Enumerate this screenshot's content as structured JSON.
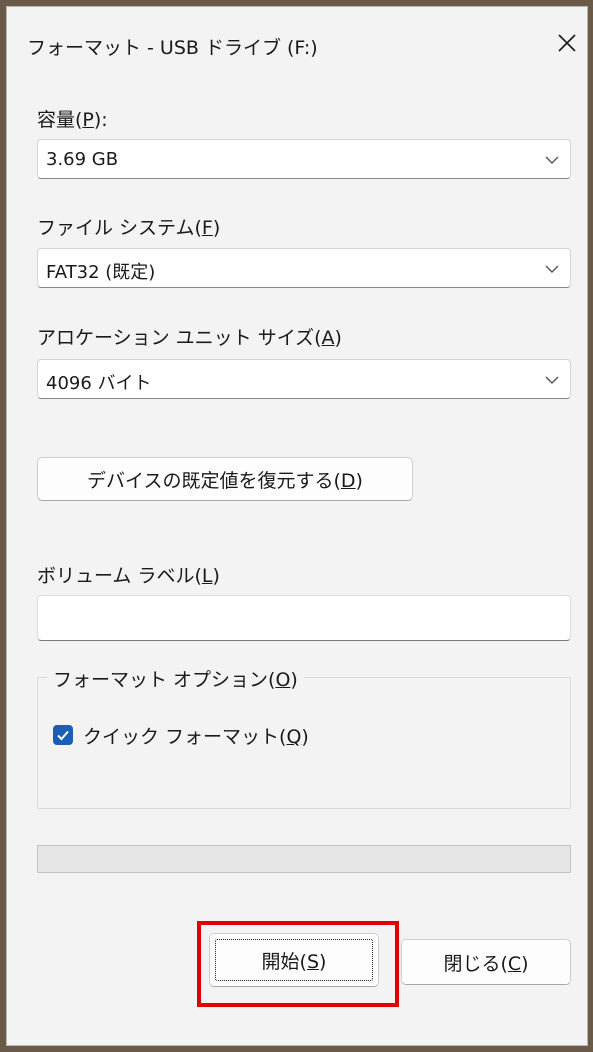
{
  "dialog": {
    "title": "フォーマット - USB ドライブ (F:)"
  },
  "capacity": {
    "label_text": "容量(",
    "label_key": "P",
    "label_end": "):",
    "value": "3.69 GB"
  },
  "filesystem": {
    "label_text": "ファイル システム(",
    "label_key": "F",
    "label_end": ")",
    "value": "FAT32 (既定)"
  },
  "allocation": {
    "label_text": "アロケーション ユニット サイズ(",
    "label_key": "A",
    "label_end": ")",
    "value": "4096 バイト"
  },
  "restore_defaults": {
    "label_text": "デバイスの既定値を復元する(",
    "label_key": "D",
    "label_end": ")"
  },
  "volume_label": {
    "label_text": "ボリューム ラベル(",
    "label_key": "L",
    "label_end": ")",
    "value": ""
  },
  "format_options": {
    "legend_text": "フォーマット オプション(",
    "legend_key": "O",
    "legend_end": ")",
    "quick_format": {
      "label_text": "クイック フォーマット(",
      "label_key": "Q",
      "label_end": ")",
      "checked": true
    }
  },
  "progress": {
    "value": 0
  },
  "buttons": {
    "start": {
      "label_text": "開始(",
      "label_key": "S",
      "label_end": ")"
    },
    "close": {
      "label_text": "閉じる(",
      "label_key": "C",
      "label_end": ")"
    }
  },
  "colors": {
    "accent": "#1a5fb4",
    "highlight": "#e00000"
  }
}
